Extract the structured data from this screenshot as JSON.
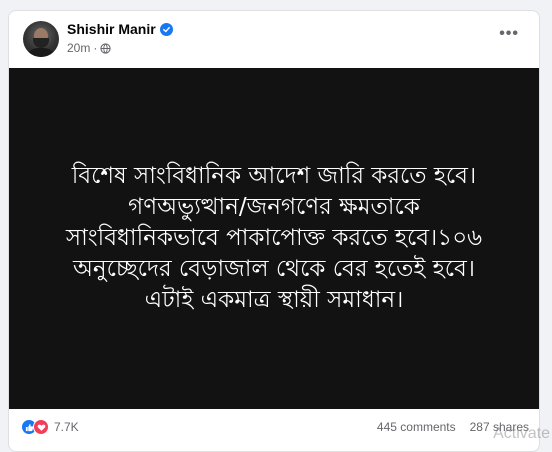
{
  "post": {
    "author": "Shishir Manir",
    "time": "20m",
    "privacy_icon": "globe-icon",
    "more_icon": "more-options-icon",
    "more_label": "•••",
    "verified_icon": "verified-badge-icon",
    "text": "বিশেষ সাংবিধানিক আদেশ জারি করতে হবে।গণঅভ্যুত্থান/জনগণের ক্ষমতাকে সাংবিধানিকভাবে পাকাপোক্ত করতে হবে।১০৬ অনুচ্ছেদের বেড়াজাল থেকে বের হতেই হবে। এটাই একমাত্র স্থায়ী সমাধান।",
    "background_color": "#121212",
    "text_color": "#ffffff"
  },
  "stats": {
    "reactions": "7.7K",
    "comments": "445 comments",
    "shares": "287 shares",
    "reaction_icons": [
      "like-icon",
      "love-icon"
    ]
  },
  "watermark": "Activate",
  "colors": {
    "accent": "#1877f2",
    "love": "#f33e58",
    "secondary_text": "#65676b"
  }
}
